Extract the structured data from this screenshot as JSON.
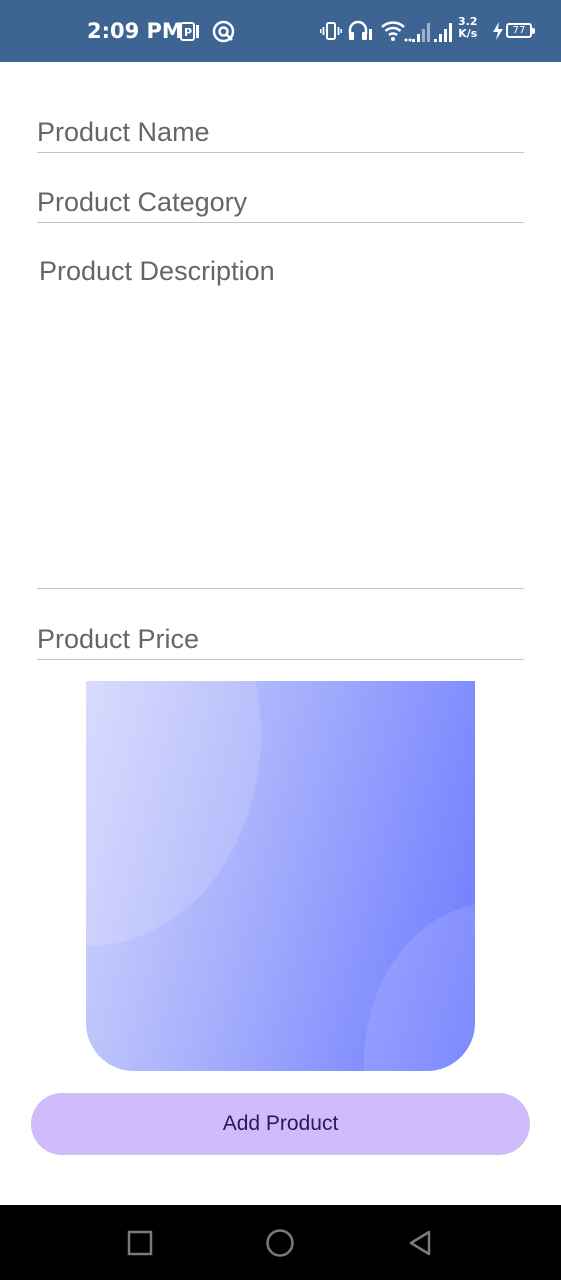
{
  "status_bar": {
    "time": "2:09 PM",
    "network_speed_value": "3.2",
    "network_speed_unit": "K/s",
    "battery_level": "77",
    "icons": [
      "notification-p-icon",
      "vpn-icon",
      "vibrate-icon",
      "headphones-icon",
      "wifi-icon",
      "signal-1-icon",
      "signal-2-icon",
      "charging-icon",
      "battery-icon"
    ],
    "background_color": "#3e6494"
  },
  "form": {
    "product_name": {
      "placeholder": "Product Name",
      "value": ""
    },
    "product_category": {
      "placeholder": "Product Category",
      "value": ""
    },
    "product_description": {
      "placeholder": "Product Description",
      "value": ""
    },
    "product_price": {
      "placeholder": "Product Price",
      "value": ""
    }
  },
  "image_picker": {
    "gradient_colors": [
      "#d3d6fd",
      "#aab3fc",
      "#8591fe",
      "#6c79fe"
    ]
  },
  "add_button": {
    "label": "Add Product",
    "background_color": "#d1bcfb",
    "text_color": "#2a1a55"
  },
  "nav_bar": {
    "buttons": [
      "recents-square-icon",
      "home-circle-icon",
      "back-triangle-icon"
    ]
  }
}
